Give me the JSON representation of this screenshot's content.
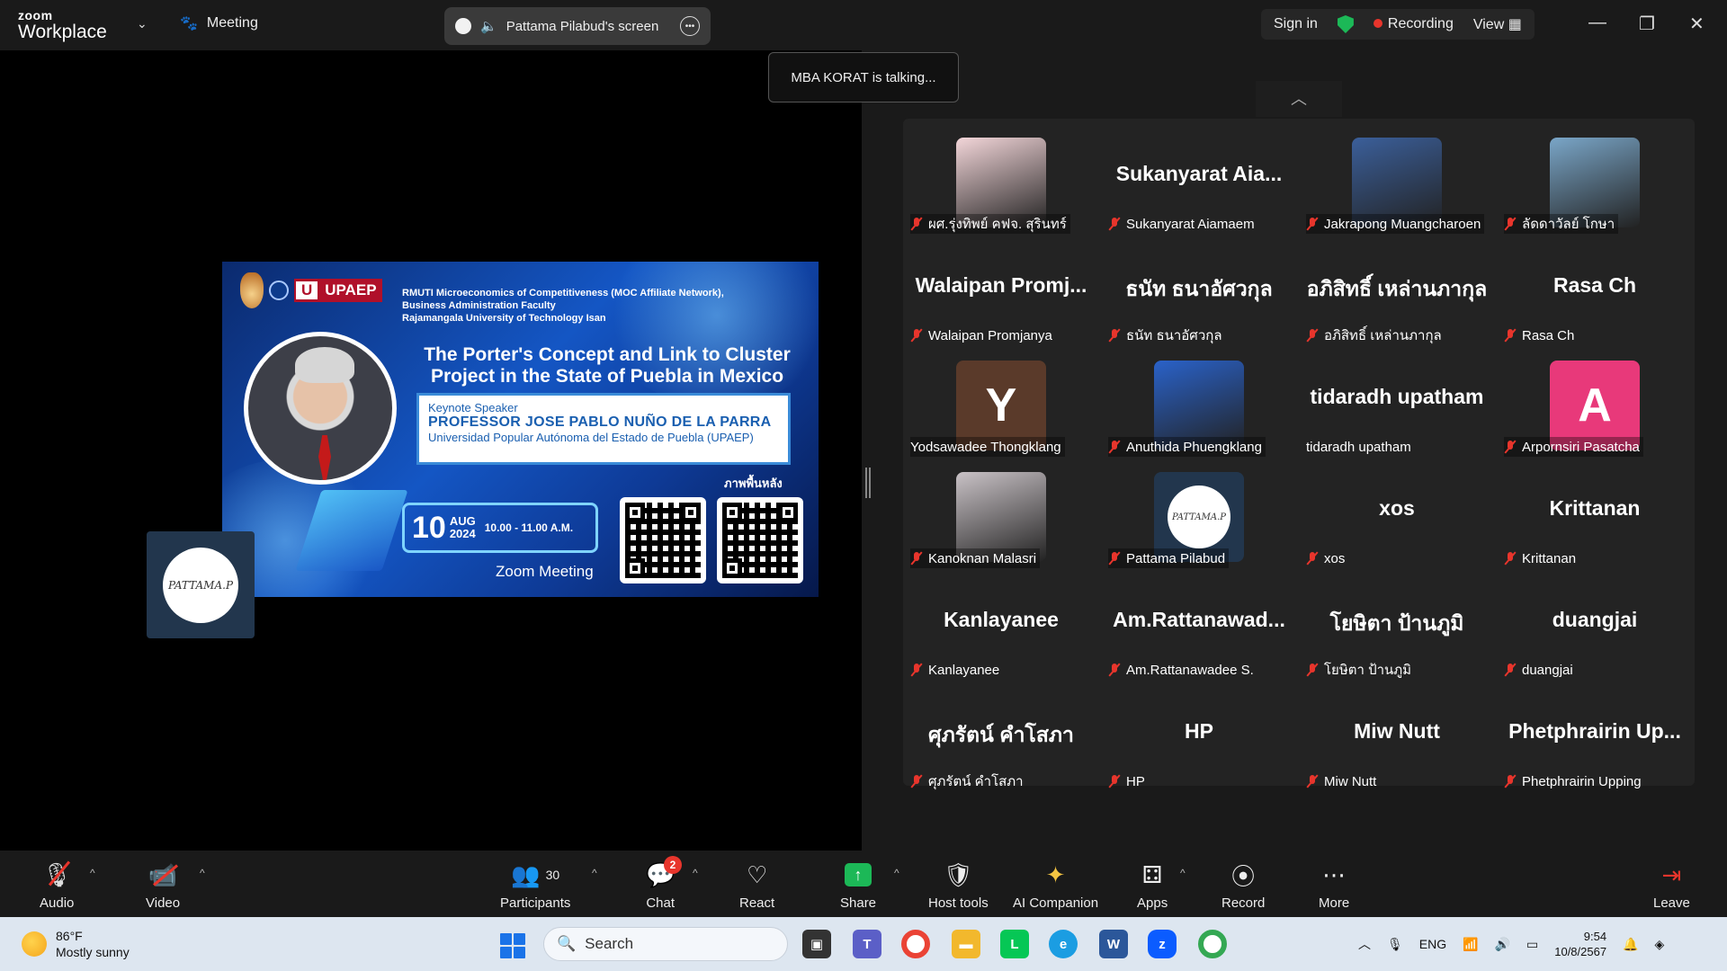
{
  "app": {
    "logo_small": "zoom",
    "logo_big": "Workplace"
  },
  "topbar": {
    "meeting_label": "Meeting",
    "screen_share_label": "Pattama Pilabud's screen",
    "sign_in": "Sign in",
    "recording": "Recording",
    "view": "View"
  },
  "toast": {
    "talking": "MBA KORAT is talking..."
  },
  "slide": {
    "org_line1": "RMUTI Microeconomics of Competitiveness (MOC Affiliate Network),",
    "org_line2": "Business Administration Faculty",
    "org_line3": "Rajamangala University of Technology Isan",
    "brand": "UPAEP",
    "title_line1": "The Porter's Concept and Link to Cluster",
    "title_line2": "Project in the State of Puebla in Mexico",
    "keynote_label": "Keynote Speaker",
    "speaker": "PROFESSOR JOSE PABLO NUÑO DE LA PARRA",
    "affiliation": "Universidad Popular Autónoma del Estado de Puebla (UPAEP)",
    "background_label": "ภาพพื้นหลัง",
    "day": "10",
    "month": "AUG",
    "year": "2024",
    "time": "10.00 - 11.00 A.M.",
    "platform": "Zoom Meeting"
  },
  "self_view": {
    "avatar_text": "PATTAMA.P"
  },
  "participants": [
    {
      "name": "ผศ.รุ่งทิพย์  คฟจ. สุรินทร์",
      "big": "",
      "kind": "img",
      "color": "#f3d6d9",
      "muted": true
    },
    {
      "name": "Sukanyarat Aiamaem",
      "big": "Sukanyarat  Aia...",
      "kind": "text",
      "muted": true
    },
    {
      "name": "Jakrapong Muangcharoen",
      "big": "",
      "kind": "img",
      "color": "#3b5f9a",
      "muted": true
    },
    {
      "name": "ลัดดาวัลย์ โกษา",
      "big": "",
      "kind": "img",
      "color": "#7aa6c8",
      "muted": true
    },
    {
      "name": "Walaipan Promjanya",
      "big": "Walaipan  Promj...",
      "kind": "text",
      "muted": true
    },
    {
      "name": "ธนัท ธนาอัศวกุล",
      "big": "ธนัท ธนาอัศวกุล",
      "kind": "text",
      "muted": true
    },
    {
      "name": "อภิสิทธิ์ เหล่านภากุล",
      "big": "อภิสิทธิ์ เหล่านภากุล",
      "kind": "text",
      "muted": true
    },
    {
      "name": "Rasa Ch",
      "big": "Rasa Ch",
      "kind": "text",
      "muted": true
    },
    {
      "name": "Yodsawadee Thongklang",
      "big": "Y",
      "kind": "letter",
      "color": "#5a3a2a",
      "muted": false
    },
    {
      "name": "Anuthida Phuengklang",
      "big": "",
      "kind": "img",
      "color": "#2a62c9",
      "muted": true
    },
    {
      "name": "tidaradh upatham",
      "big": "tidaradh  upatham",
      "kind": "text",
      "muted": false
    },
    {
      "name": "Arpornsiri Pasatcha",
      "big": "A",
      "kind": "letter",
      "color": "#e8397a",
      "muted": true
    },
    {
      "name": "Kanoknan Malasri",
      "big": "",
      "kind": "img",
      "color": "#c9c2c6",
      "muted": true
    },
    {
      "name": "Pattama Pilabud",
      "big": "PATTAMA.P",
      "kind": "avatar",
      "color": "#22364d",
      "muted": true
    },
    {
      "name": "xos",
      "big": "xos",
      "kind": "text",
      "muted": true
    },
    {
      "name": "Krittanan",
      "big": "Krittanan",
      "kind": "text",
      "muted": true
    },
    {
      "name": "Kanlayanee",
      "big": "Kanlayanee",
      "kind": "text",
      "muted": true
    },
    {
      "name": "Am.Rattanawadee S.",
      "big": "Am.Rattanawad...",
      "kind": "text",
      "muted": true
    },
    {
      "name": "โยษิตา ป้านภูมิ",
      "big": "โยษิตา ป้านภูมิ",
      "kind": "text",
      "muted": true
    },
    {
      "name": "duangjai",
      "big": "duangjai",
      "kind": "text",
      "muted": true
    },
    {
      "name": "ศุภรัตน์  คำโสภา",
      "big": "ศุภรัตน์  คำโสภา",
      "kind": "text",
      "muted": true
    },
    {
      "name": "HP",
      "big": "HP",
      "kind": "text",
      "muted": true
    },
    {
      "name": "Miw Nutt",
      "big": "Miw Nutt",
      "kind": "text",
      "muted": true
    },
    {
      "name": "Phetphrairin Upping",
      "big": "Phetphrairin  Up...",
      "kind": "text",
      "muted": true
    }
  ],
  "toolbar": {
    "audio": "Audio",
    "video": "Video",
    "participants": "Participants",
    "participants_count": "30",
    "chat": "Chat",
    "chat_badge": "2",
    "react": "React",
    "share": "Share",
    "host_tools": "Host tools",
    "ai_companion": "AI Companion",
    "apps": "Apps",
    "record": "Record",
    "more": "More",
    "leave": "Leave"
  },
  "taskbar": {
    "temperature": "86°F",
    "weather": "Mostly sunny",
    "search": "Search",
    "language": "ENG",
    "time": "9:54",
    "date": "10/8/2567"
  },
  "colors": {
    "accent_green": "#1cb857",
    "record_red": "#e8352c",
    "share_green": "#1cb857"
  }
}
